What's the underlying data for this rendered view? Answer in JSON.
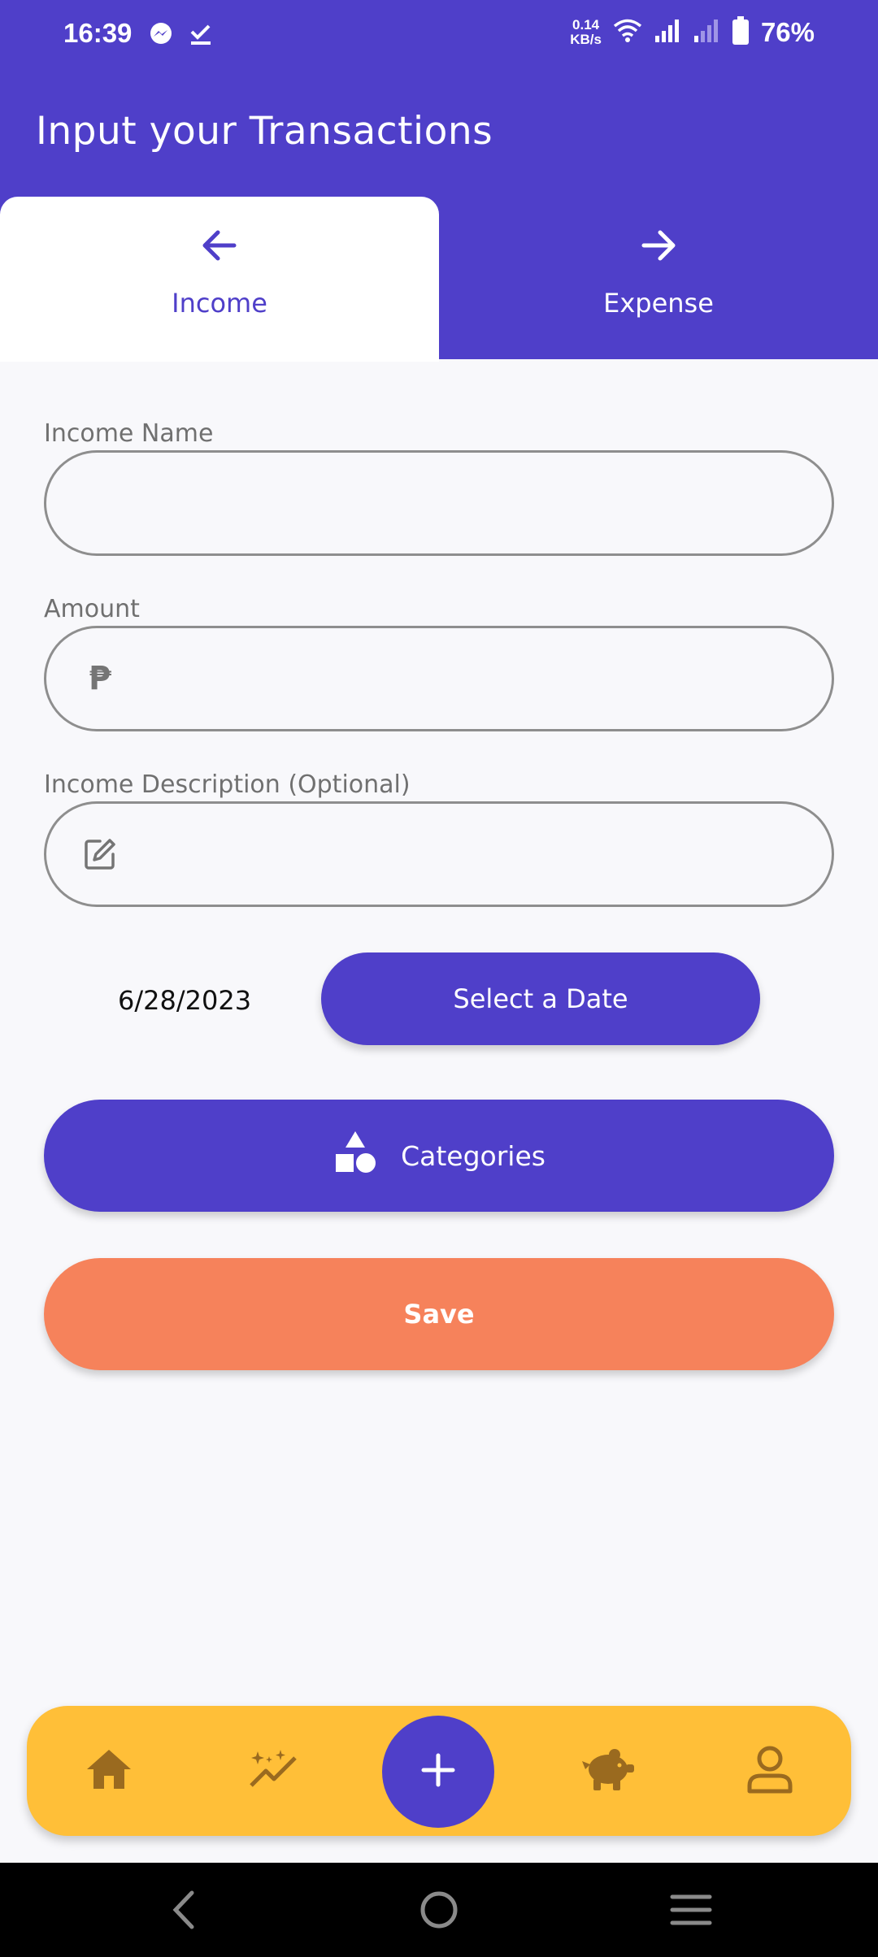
{
  "status_bar": {
    "time": "16:39",
    "net_speed_value": "0.14",
    "net_speed_unit": "KB/s",
    "battery": "76%",
    "icons": [
      "messenger-icon",
      "check-icon",
      "wifi-icon",
      "signal-icon",
      "signal-weak-icon",
      "battery-icon"
    ]
  },
  "header": {
    "title": "Input your Transactions"
  },
  "tabs": [
    {
      "label": "Income",
      "icon": "arrow-left-icon",
      "selected": true
    },
    {
      "label": "Expense",
      "icon": "arrow-right-icon",
      "selected": false
    }
  ],
  "form": {
    "name_label": "Income Name",
    "name_value": "",
    "amount_label": "Amount",
    "amount_value": "",
    "currency_symbol": "₱",
    "description_label": "Income Description (Optional)",
    "description_value": "",
    "date_value": "6/28/2023",
    "select_date_label": "Select a Date",
    "categories_label": "Categories",
    "save_label": "Save"
  },
  "bottom_nav": {
    "items": [
      "home-icon",
      "insights-icon",
      "add-icon",
      "savings-icon",
      "profile-icon"
    ]
  },
  "colors": {
    "primary": "#4F3FC9",
    "save": "#F6825B",
    "nav_bg": "#FFBF38",
    "nav_icon": "#9A6A1F"
  }
}
